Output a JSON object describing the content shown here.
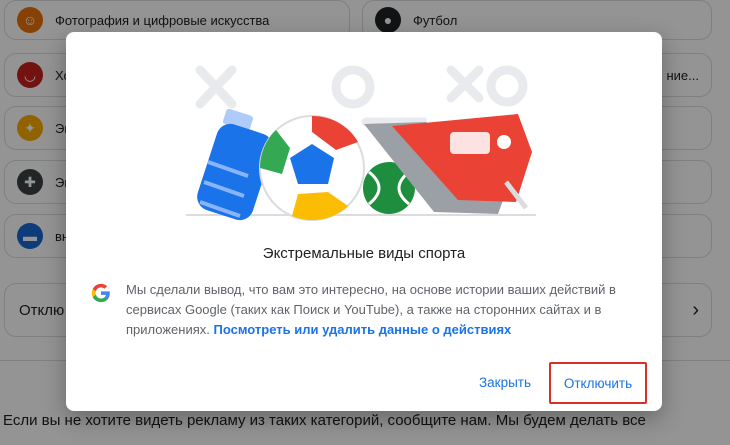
{
  "background": {
    "cards": [
      {
        "label": "Фотография и цифровые искусства",
        "icon": "theater-masks-icon"
      },
      {
        "label": "Футбол",
        "icon": "soccer-ball-icon"
      },
      {
        "label": "Хо",
        "icon": "food-bowl-icon"
      },
      {
        "label": "ние...",
        "icon": ""
      },
      {
        "label": "Эк",
        "icon": "compass-icon"
      },
      {
        "label": "Эк",
        "icon": "gamepad-icon"
      },
      {
        "label": "вн",
        "icon": "car-icon"
      }
    ],
    "disable_row_label": "Отклю",
    "bottom_text": "Если вы не хотите видеть рекламу из таких категорий, сообщите нам. Мы будем делать все"
  },
  "dialog": {
    "title": "Экстремальные виды спорта",
    "body_text": "Мы сделали вывод, что вам это интересно, на основе истории ваших действий в сервисах Google (таких как Поиск и YouTube), а также на сторонних сайтах и в приложениях.",
    "link_text": "Посмотреть или удалить данные о действиях",
    "close_label": "Закрыть",
    "disable_label": "Отключить",
    "highlight_color": "#d93025",
    "link_color": "#1a73e8"
  }
}
